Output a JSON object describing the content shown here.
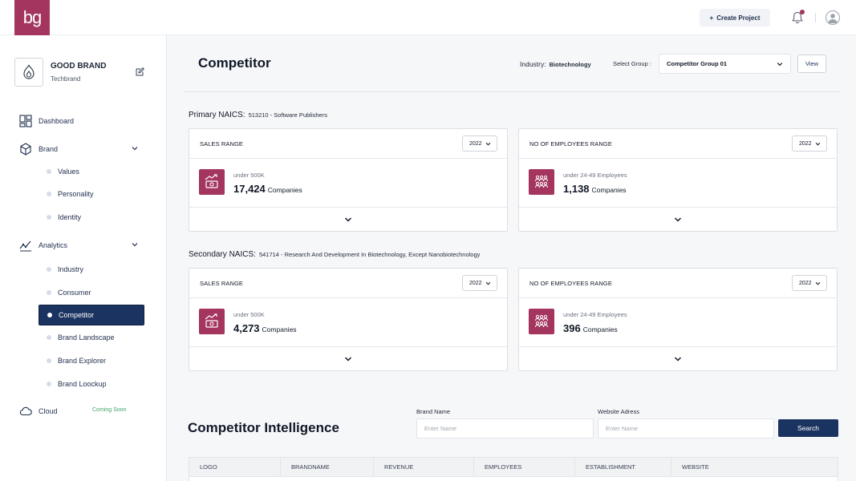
{
  "header": {
    "logo_text": "bg",
    "create_project_label": "Create Project",
    "brand_color": "#a3355f"
  },
  "sidebar": {
    "brand_name": "GOOD BRAND",
    "brand_sub": "Techbrand",
    "nav": {
      "dashboard": "Dashboard",
      "brand": "Brand",
      "analytics": "Analytics",
      "cloud": "Cloud"
    },
    "brand_items": [
      "Values",
      "Personality",
      "Identity"
    ],
    "analytics_items": [
      "Industry",
      "Consumer",
      "Competitor",
      "Brand Landscape",
      "Brand Explorer",
      "Brand Loockup"
    ],
    "active_item": "Competitor",
    "cloud_badge": "Coming Soon"
  },
  "page": {
    "title": "Competitor",
    "industry_label": "Industry:",
    "industry_value": "Biotechnology",
    "group_label": "Select Group :",
    "group_value": "Competitor Group 01",
    "view_label": "View"
  },
  "primary": {
    "label": "Primary NAICS:",
    "code": "513210 - Software Publishers",
    "sales": {
      "title": "SALES RANGE",
      "year": "2022",
      "sub": "under 500K",
      "count": "17,424",
      "unit": "Companies"
    },
    "employees": {
      "title": "NO OF EMPLOYEES RANGE",
      "year": "2022",
      "sub": "under 24-49 Employees",
      "count": "1,138",
      "unit": "Companies"
    }
  },
  "secondary": {
    "label": "Secondary NAICS:",
    "code": "541714 - Research And Development In Biotechnology, Except Nanobiotechnology",
    "sales": {
      "title": "SALES RANGE",
      "year": "2022",
      "sub": "under 500K",
      "count": "4,273",
      "unit": "Companies"
    },
    "employees": {
      "title": "NO OF EMPLOYEES RANGE",
      "year": "2022",
      "sub": "under 24-49 Employees",
      "count": "396",
      "unit": "Companies"
    }
  },
  "intelligence": {
    "title": "Competitor Intelligence",
    "brand_name_label": "Brand Name",
    "brand_name_placeholder": "Enter Name",
    "website_label": "Website Adress",
    "website_placeholder": "Enter Name",
    "search_label": "Search",
    "columns": [
      "LOGO",
      "BRANDNAME",
      "REVENUE",
      "EMPLOYEES",
      "ESTABLISHMENT",
      "WEBSITE"
    ]
  }
}
